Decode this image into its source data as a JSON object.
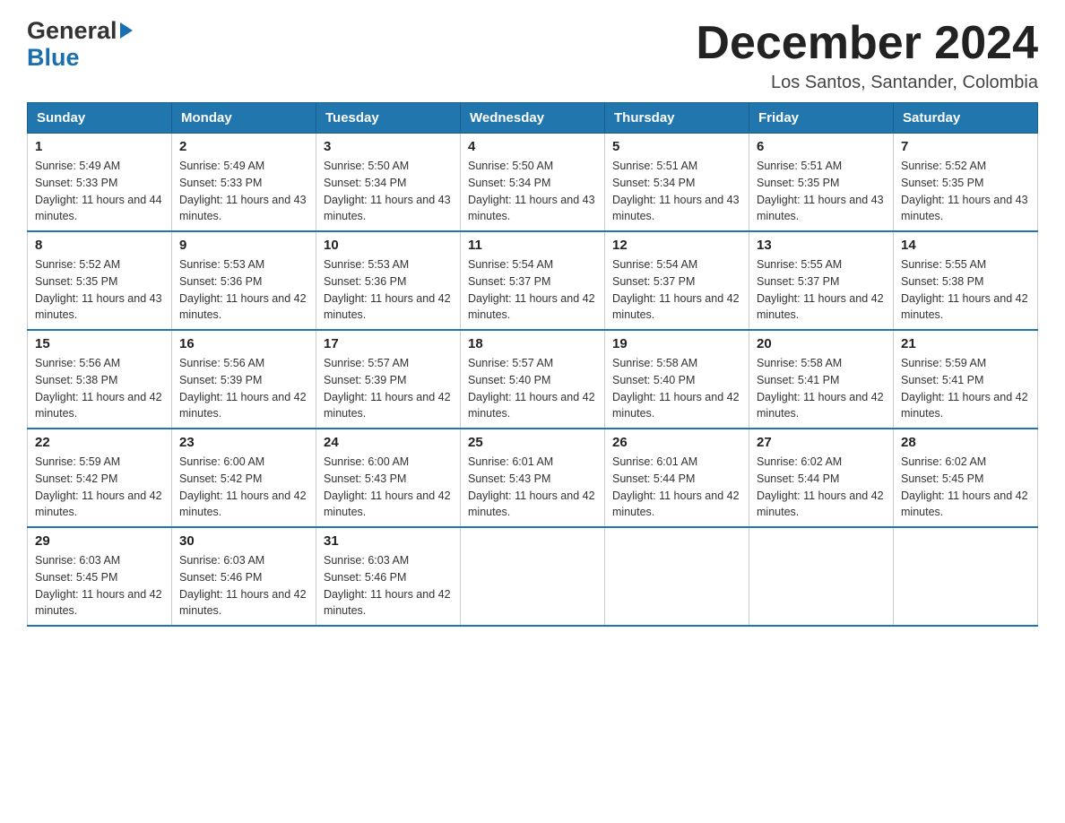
{
  "header": {
    "logo_general": "General",
    "logo_arrow": "▶",
    "logo_blue": "Blue",
    "month_title": "December 2024",
    "location": "Los Santos, Santander, Colombia"
  },
  "weekdays": [
    "Sunday",
    "Monday",
    "Tuesday",
    "Wednesday",
    "Thursday",
    "Friday",
    "Saturday"
  ],
  "weeks": [
    [
      {
        "day": "1",
        "sunrise": "5:49 AM",
        "sunset": "5:33 PM",
        "daylight": "11 hours and 44 minutes."
      },
      {
        "day": "2",
        "sunrise": "5:49 AM",
        "sunset": "5:33 PM",
        "daylight": "11 hours and 43 minutes."
      },
      {
        "day": "3",
        "sunrise": "5:50 AM",
        "sunset": "5:34 PM",
        "daylight": "11 hours and 43 minutes."
      },
      {
        "day": "4",
        "sunrise": "5:50 AM",
        "sunset": "5:34 PM",
        "daylight": "11 hours and 43 minutes."
      },
      {
        "day": "5",
        "sunrise": "5:51 AM",
        "sunset": "5:34 PM",
        "daylight": "11 hours and 43 minutes."
      },
      {
        "day": "6",
        "sunrise": "5:51 AM",
        "sunset": "5:35 PM",
        "daylight": "11 hours and 43 minutes."
      },
      {
        "day": "7",
        "sunrise": "5:52 AM",
        "sunset": "5:35 PM",
        "daylight": "11 hours and 43 minutes."
      }
    ],
    [
      {
        "day": "8",
        "sunrise": "5:52 AM",
        "sunset": "5:35 PM",
        "daylight": "11 hours and 43 minutes."
      },
      {
        "day": "9",
        "sunrise": "5:53 AM",
        "sunset": "5:36 PM",
        "daylight": "11 hours and 42 minutes."
      },
      {
        "day": "10",
        "sunrise": "5:53 AM",
        "sunset": "5:36 PM",
        "daylight": "11 hours and 42 minutes."
      },
      {
        "day": "11",
        "sunrise": "5:54 AM",
        "sunset": "5:37 PM",
        "daylight": "11 hours and 42 minutes."
      },
      {
        "day": "12",
        "sunrise": "5:54 AM",
        "sunset": "5:37 PM",
        "daylight": "11 hours and 42 minutes."
      },
      {
        "day": "13",
        "sunrise": "5:55 AM",
        "sunset": "5:37 PM",
        "daylight": "11 hours and 42 minutes."
      },
      {
        "day": "14",
        "sunrise": "5:55 AM",
        "sunset": "5:38 PM",
        "daylight": "11 hours and 42 minutes."
      }
    ],
    [
      {
        "day": "15",
        "sunrise": "5:56 AM",
        "sunset": "5:38 PM",
        "daylight": "11 hours and 42 minutes."
      },
      {
        "day": "16",
        "sunrise": "5:56 AM",
        "sunset": "5:39 PM",
        "daylight": "11 hours and 42 minutes."
      },
      {
        "day": "17",
        "sunrise": "5:57 AM",
        "sunset": "5:39 PM",
        "daylight": "11 hours and 42 minutes."
      },
      {
        "day": "18",
        "sunrise": "5:57 AM",
        "sunset": "5:40 PM",
        "daylight": "11 hours and 42 minutes."
      },
      {
        "day": "19",
        "sunrise": "5:58 AM",
        "sunset": "5:40 PM",
        "daylight": "11 hours and 42 minutes."
      },
      {
        "day": "20",
        "sunrise": "5:58 AM",
        "sunset": "5:41 PM",
        "daylight": "11 hours and 42 minutes."
      },
      {
        "day": "21",
        "sunrise": "5:59 AM",
        "sunset": "5:41 PM",
        "daylight": "11 hours and 42 minutes."
      }
    ],
    [
      {
        "day": "22",
        "sunrise": "5:59 AM",
        "sunset": "5:42 PM",
        "daylight": "11 hours and 42 minutes."
      },
      {
        "day": "23",
        "sunrise": "6:00 AM",
        "sunset": "5:42 PM",
        "daylight": "11 hours and 42 minutes."
      },
      {
        "day": "24",
        "sunrise": "6:00 AM",
        "sunset": "5:43 PM",
        "daylight": "11 hours and 42 minutes."
      },
      {
        "day": "25",
        "sunrise": "6:01 AM",
        "sunset": "5:43 PM",
        "daylight": "11 hours and 42 minutes."
      },
      {
        "day": "26",
        "sunrise": "6:01 AM",
        "sunset": "5:44 PM",
        "daylight": "11 hours and 42 minutes."
      },
      {
        "day": "27",
        "sunrise": "6:02 AM",
        "sunset": "5:44 PM",
        "daylight": "11 hours and 42 minutes."
      },
      {
        "day": "28",
        "sunrise": "6:02 AM",
        "sunset": "5:45 PM",
        "daylight": "11 hours and 42 minutes."
      }
    ],
    [
      {
        "day": "29",
        "sunrise": "6:03 AM",
        "sunset": "5:45 PM",
        "daylight": "11 hours and 42 minutes."
      },
      {
        "day": "30",
        "sunrise": "6:03 AM",
        "sunset": "5:46 PM",
        "daylight": "11 hours and 42 minutes."
      },
      {
        "day": "31",
        "sunrise": "6:03 AM",
        "sunset": "5:46 PM",
        "daylight": "11 hours and 42 minutes."
      },
      null,
      null,
      null,
      null
    ]
  ],
  "labels": {
    "sunrise_prefix": "Sunrise: ",
    "sunset_prefix": "Sunset: ",
    "daylight_prefix": "Daylight: "
  }
}
